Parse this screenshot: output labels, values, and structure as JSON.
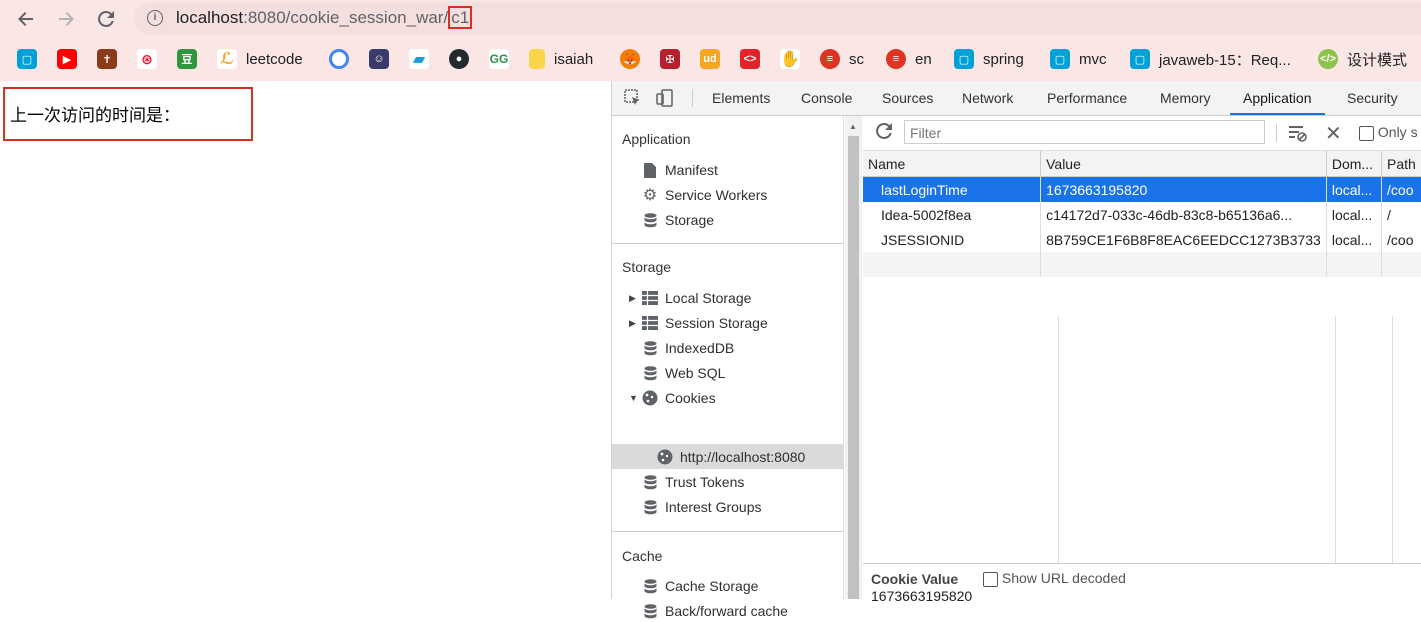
{
  "browser": {
    "url_host": "localhost",
    "url_rest": ":8080/cookie_session_war/",
    "url_highlight": "c1"
  },
  "bookmarks": [
    {
      "icon": "bilibili-icon",
      "label": "",
      "color": "#00a1d6"
    },
    {
      "icon": "youtube-icon",
      "label": "",
      "color": "#ff0000"
    },
    {
      "icon": "bible-icon",
      "label": "",
      "color": "#8b3a1a"
    },
    {
      "icon": "weibo-icon",
      "label": "",
      "color": "#e6162d"
    },
    {
      "icon": "douban-icon",
      "label": "",
      "color": "#2e963d"
    },
    {
      "icon": "leetcode-icon",
      "label": "leetcode",
      "color": "#f89f1b"
    },
    {
      "icon": "chrome-icon",
      "label": "",
      "color": "#4285f4"
    },
    {
      "icon": "anime-avatar-icon",
      "label": "",
      "color": "#3b3b6b"
    },
    {
      "icon": "tag-icon",
      "label": "",
      "color": "#1e9bd7"
    },
    {
      "icon": "github-icon",
      "label": "",
      "color": "#24292e"
    },
    {
      "icon": "geeksforgeeks-icon",
      "label": "",
      "color": "#2f8d46"
    },
    {
      "icon": "folder-icon",
      "label": "isaiah",
      "color": "#f9d649"
    },
    {
      "icon": "fox-icon",
      "label": "",
      "color": "#f57c00"
    },
    {
      "icon": "cambridge-icon",
      "label": "",
      "color": "#b5202e"
    },
    {
      "icon": "udacity-icon",
      "label": "",
      "color": "#f5a623"
    },
    {
      "icon": "fish-icon",
      "label": "",
      "color": "#e3232a"
    },
    {
      "icon": "hand-icon",
      "label": "",
      "color": "#e03a6e"
    },
    {
      "icon": "scala-icon",
      "label": "sc",
      "color": "#de3423"
    },
    {
      "icon": "scala-icon",
      "label": "en",
      "color": "#de3423"
    },
    {
      "icon": "bilibili-icon",
      "label": "spring",
      "color": "#00a1d6"
    },
    {
      "icon": "bilibili-icon",
      "label": "mvc",
      "color": "#00a1d6"
    },
    {
      "icon": "bilibili-icon",
      "label": "javaweb-15：Req...",
      "color": "#00a1d6"
    },
    {
      "icon": "design-pattern-icon",
      "label": "设计模式",
      "color": "#8bc34a"
    }
  ],
  "page": {
    "message": "上一次访问的时间是："
  },
  "devtools": {
    "tabs": [
      "Elements",
      "Console",
      "Sources",
      "Network",
      "Performance",
      "Memory",
      "Application",
      "Security"
    ],
    "active_tab": "Application",
    "sidebar": {
      "application_header": "Application",
      "application_items": [
        "Manifest",
        "Service Workers",
        "Storage"
      ],
      "storage_header": "Storage",
      "storage_items": [
        "Local Storage",
        "Session Storage",
        "IndexedDB",
        "Web SQL",
        "Cookies"
      ],
      "cookie_origin": "http://localhost:8080",
      "storage_items_after": [
        "Trust Tokens",
        "Interest Groups"
      ],
      "cache_header": "Cache",
      "cache_items": [
        "Cache Storage",
        "Back/forward cache"
      ]
    },
    "filter_placeholder": "Filter",
    "only_show_label": "Only s",
    "table": {
      "columns": [
        "Name",
        "Value",
        "Dom...",
        "Path"
      ],
      "rows": [
        {
          "name": "lastLoginTime",
          "value": "1673663195820",
          "domain": "local...",
          "path": "/coo"
        },
        {
          "name": "Idea-5002f8ea",
          "value": "c14172d7-033c-46db-83c8-b65136a6...",
          "domain": "local...",
          "path": "/"
        },
        {
          "name": "JSESSIONID",
          "value": "8B759CE1F6B8F8EAC6EEDCC1273B3733",
          "domain": "local...",
          "path": "/coo"
        }
      ]
    },
    "cookie_value_label": "Cookie Value",
    "show_url_decoded": "Show URL decoded",
    "cookie_value": "1673663195820"
  },
  "colors": {
    "topbar": "#fbe6e6",
    "selection": "#1a73e8",
    "highlight_box": "#d93025"
  }
}
